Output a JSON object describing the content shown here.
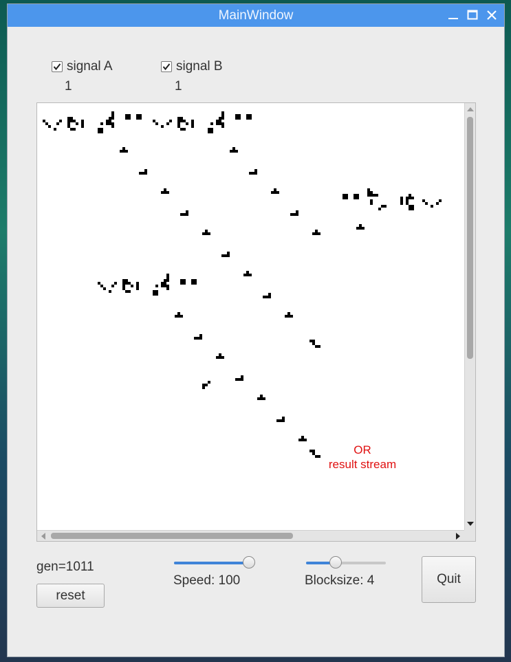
{
  "window": {
    "title": "MainWindow"
  },
  "signals": [
    {
      "label": "signal A",
      "checked": true,
      "value": "1"
    },
    {
      "label": "signal B",
      "checked": true,
      "value": "1"
    }
  ],
  "canvas": {
    "annotation_line1": "OR",
    "annotation_line2": "result stream"
  },
  "status": {
    "gen": "gen=1011"
  },
  "controls": {
    "reset_label": "reset",
    "quit_label": "Quit",
    "speed_label": "Speed: 100",
    "speed_level": 1.0,
    "blocksize_label": "Blocksize: 4",
    "blocksize_level": 0.35
  },
  "colors": {
    "titlebar": "#4c96ec",
    "annotation": "#e01010",
    "slider_fill": "#3f84d8"
  }
}
